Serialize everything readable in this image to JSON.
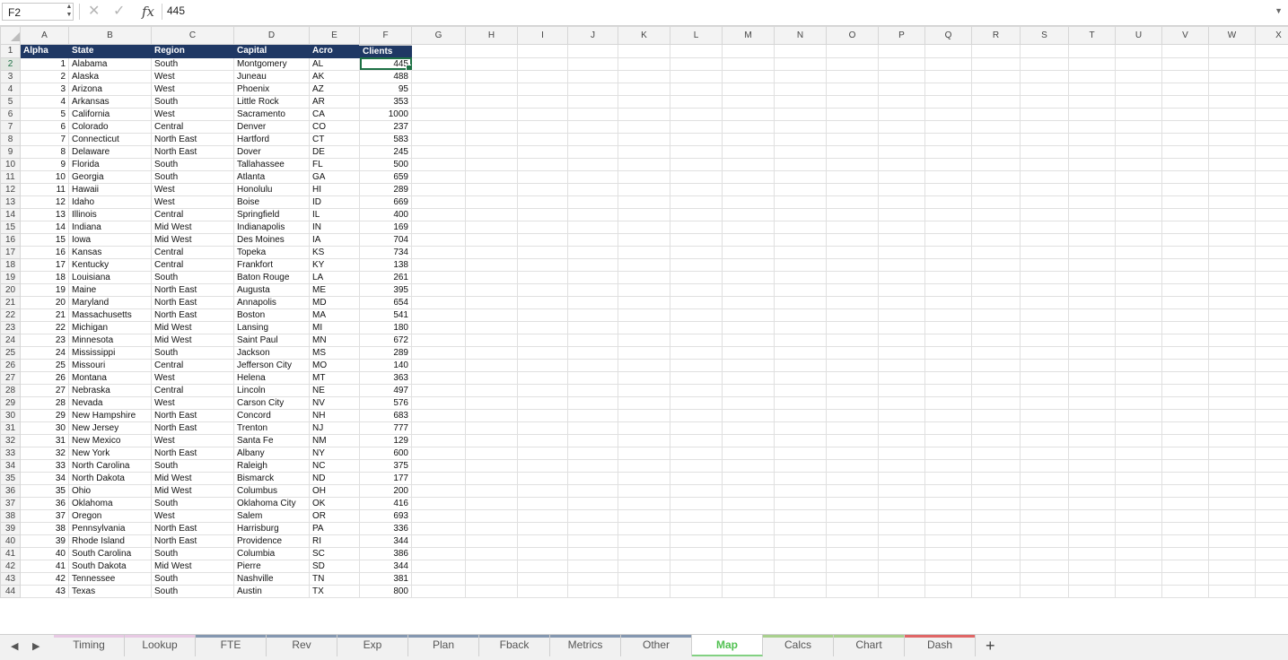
{
  "formula_bar": {
    "name_box": "F2",
    "cancel_icon": "✕",
    "confirm_icon": "✓",
    "fx_label": "fx",
    "value": "445"
  },
  "columns": [
    "A",
    "B",
    "C",
    "D",
    "E",
    "F",
    "G",
    "H",
    "I",
    "J",
    "K",
    "L",
    "M",
    "N",
    "O",
    "P",
    "Q",
    "R",
    "S",
    "T",
    "U",
    "V",
    "W",
    "X"
  ],
  "header_row": [
    "Alpha",
    "State",
    "Region",
    "Capital",
    "Acro",
    "Clients"
  ],
  "rows": [
    [
      1,
      "Alabama",
      "South",
      "Montgomery",
      "AL",
      445
    ],
    [
      2,
      "Alaska",
      "West",
      "Juneau",
      "AK",
      488
    ],
    [
      3,
      "Arizona",
      "West",
      "Phoenix",
      "AZ",
      95
    ],
    [
      4,
      "Arkansas",
      "South",
      "Little Rock",
      "AR",
      353
    ],
    [
      5,
      "California",
      "West",
      "Sacramento",
      "CA",
      1000
    ],
    [
      6,
      "Colorado",
      "Central",
      "Denver",
      "CO",
      237
    ],
    [
      7,
      "Connecticut",
      "North East",
      "Hartford",
      "CT",
      583
    ],
    [
      8,
      "Delaware",
      "North East",
      "Dover",
      "DE",
      245
    ],
    [
      9,
      "Florida",
      "South",
      "Tallahassee",
      "FL",
      500
    ],
    [
      10,
      "Georgia",
      "South",
      "Atlanta",
      "GA",
      659
    ],
    [
      11,
      "Hawaii",
      "West",
      "Honolulu",
      "HI",
      289
    ],
    [
      12,
      "Idaho",
      "West",
      "Boise",
      "ID",
      669
    ],
    [
      13,
      "Illinois",
      "Central",
      "Springfield",
      "IL",
      400
    ],
    [
      14,
      "Indiana",
      "Mid West",
      "Indianapolis",
      "IN",
      169
    ],
    [
      15,
      "Iowa",
      "Mid West",
      "Des Moines",
      "IA",
      704
    ],
    [
      16,
      "Kansas",
      "Central",
      "Topeka",
      "KS",
      734
    ],
    [
      17,
      "Kentucky",
      "Central",
      "Frankfort",
      "KY",
      138
    ],
    [
      18,
      "Louisiana",
      "South",
      "Baton Rouge",
      "LA",
      261
    ],
    [
      19,
      "Maine",
      "North East",
      "Augusta",
      "ME",
      395
    ],
    [
      20,
      "Maryland",
      "North East",
      "Annapolis",
      "MD",
      654
    ],
    [
      21,
      "Massachusetts",
      "North East",
      "Boston",
      "MA",
      541
    ],
    [
      22,
      "Michigan",
      "Mid West",
      "Lansing",
      "MI",
      180
    ],
    [
      23,
      "Minnesota",
      "Mid West",
      "Saint Paul",
      "MN",
      672
    ],
    [
      24,
      "Mississippi",
      "South",
      "Jackson",
      "MS",
      289
    ],
    [
      25,
      "Missouri",
      "Central",
      "Jefferson City",
      "MO",
      140
    ],
    [
      26,
      "Montana",
      "West",
      "Helena",
      "MT",
      363
    ],
    [
      27,
      "Nebraska",
      "Central",
      "Lincoln",
      "NE",
      497
    ],
    [
      28,
      "Nevada",
      "West",
      "Carson City",
      "NV",
      576
    ],
    [
      29,
      "New Hampshire",
      "North East",
      "Concord",
      "NH",
      683
    ],
    [
      30,
      "New Jersey",
      "North East",
      "Trenton",
      "NJ",
      777
    ],
    [
      31,
      "New Mexico",
      "West",
      "Santa Fe",
      "NM",
      129
    ],
    [
      32,
      "New York",
      "North East",
      "Albany",
      "NY",
      600
    ],
    [
      33,
      "North Carolina",
      "South",
      "Raleigh",
      "NC",
      375
    ],
    [
      34,
      "North Dakota",
      "Mid West",
      "Bismarck",
      "ND",
      177
    ],
    [
      35,
      "Ohio",
      "Mid West",
      "Columbus",
      "OH",
      200
    ],
    [
      36,
      "Oklahoma",
      "South",
      "Oklahoma City",
      "OK",
      416
    ],
    [
      37,
      "Oregon",
      "West",
      "Salem",
      "OR",
      693
    ],
    [
      38,
      "Pennsylvania",
      "North East",
      "Harrisburg",
      "PA",
      336
    ],
    [
      39,
      "Rhode Island",
      "North East",
      "Providence",
      "RI",
      344
    ],
    [
      40,
      "South Carolina",
      "South",
      "Columbia",
      "SC",
      386
    ],
    [
      41,
      "South Dakota",
      "Mid West",
      "Pierre",
      "SD",
      344
    ],
    [
      42,
      "Tennessee",
      "South",
      "Nashville",
      "TN",
      381
    ],
    [
      43,
      "Texas",
      "South",
      "Austin",
      "TX",
      800
    ]
  ],
  "selected": {
    "row": 2,
    "col": "F"
  },
  "tabs": [
    {
      "label": "Timing",
      "color": "#e7c9e3",
      "active": false
    },
    {
      "label": "Lookup",
      "color": "#e7c9e3",
      "active": false
    },
    {
      "label": "FTE",
      "color": "#8497b0",
      "active": false
    },
    {
      "label": "Rev",
      "color": "#8497b0",
      "active": false
    },
    {
      "label": "Exp",
      "color": "#8497b0",
      "active": false
    },
    {
      "label": "Plan",
      "color": "#8497b0",
      "active": false
    },
    {
      "label": "Fback",
      "color": "#8497b0",
      "active": false
    },
    {
      "label": "Metrics",
      "color": "#8497b0",
      "active": false
    },
    {
      "label": "Other",
      "color": "#8497b0",
      "active": false
    },
    {
      "label": "Map",
      "color": "#a9d08e",
      "active": true
    },
    {
      "label": "Calcs",
      "color": "#a9d08e",
      "active": false
    },
    {
      "label": "Chart",
      "color": "#a9d08e",
      "active": false
    },
    {
      "label": "Dash",
      "color": "#e06666",
      "active": false
    }
  ],
  "nav": {
    "prev": "◀",
    "next": "▶",
    "add": "+"
  },
  "colors": {
    "header_fill": "#1f3864",
    "selection": "#1e7145",
    "active_tab": "#52c152"
  }
}
